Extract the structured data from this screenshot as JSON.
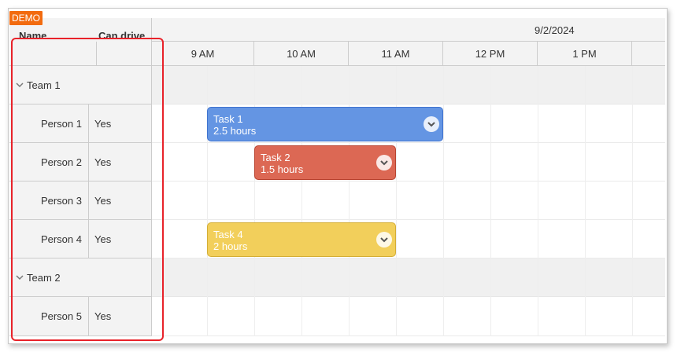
{
  "demo_badge": "DEMO",
  "columns": {
    "name": "Name",
    "can_drive": "Can drive"
  },
  "timeline": {
    "date": "9/2/2024",
    "hours": [
      "9 AM",
      "10 AM",
      "11 AM",
      "12 PM",
      "1 PM",
      ""
    ]
  },
  "rows": {
    "team1": {
      "label": "Team 1"
    },
    "p1": {
      "name": "Person 1",
      "can_drive": "Yes"
    },
    "p2": {
      "name": "Person 2",
      "can_drive": "Yes"
    },
    "p3": {
      "name": "Person 3",
      "can_drive": "Yes"
    },
    "p4": {
      "name": "Person 4",
      "can_drive": "Yes"
    },
    "team2": {
      "label": "Team 2"
    },
    "p5": {
      "name": "Person 5",
      "can_drive": "Yes"
    }
  },
  "events": {
    "task1": {
      "title": "Task 1",
      "duration": "2.5 hours",
      "color": "#6495e3"
    },
    "task2": {
      "title": "Task 2",
      "duration": "1.5 hours",
      "color": "#dc6854"
    },
    "task4": {
      "title": "Task 4",
      "duration": "2 hours",
      "color": "#f2cf5b"
    }
  },
  "colors": {
    "highlight": "#e8222a",
    "demo_badge": "#f26b0f"
  }
}
